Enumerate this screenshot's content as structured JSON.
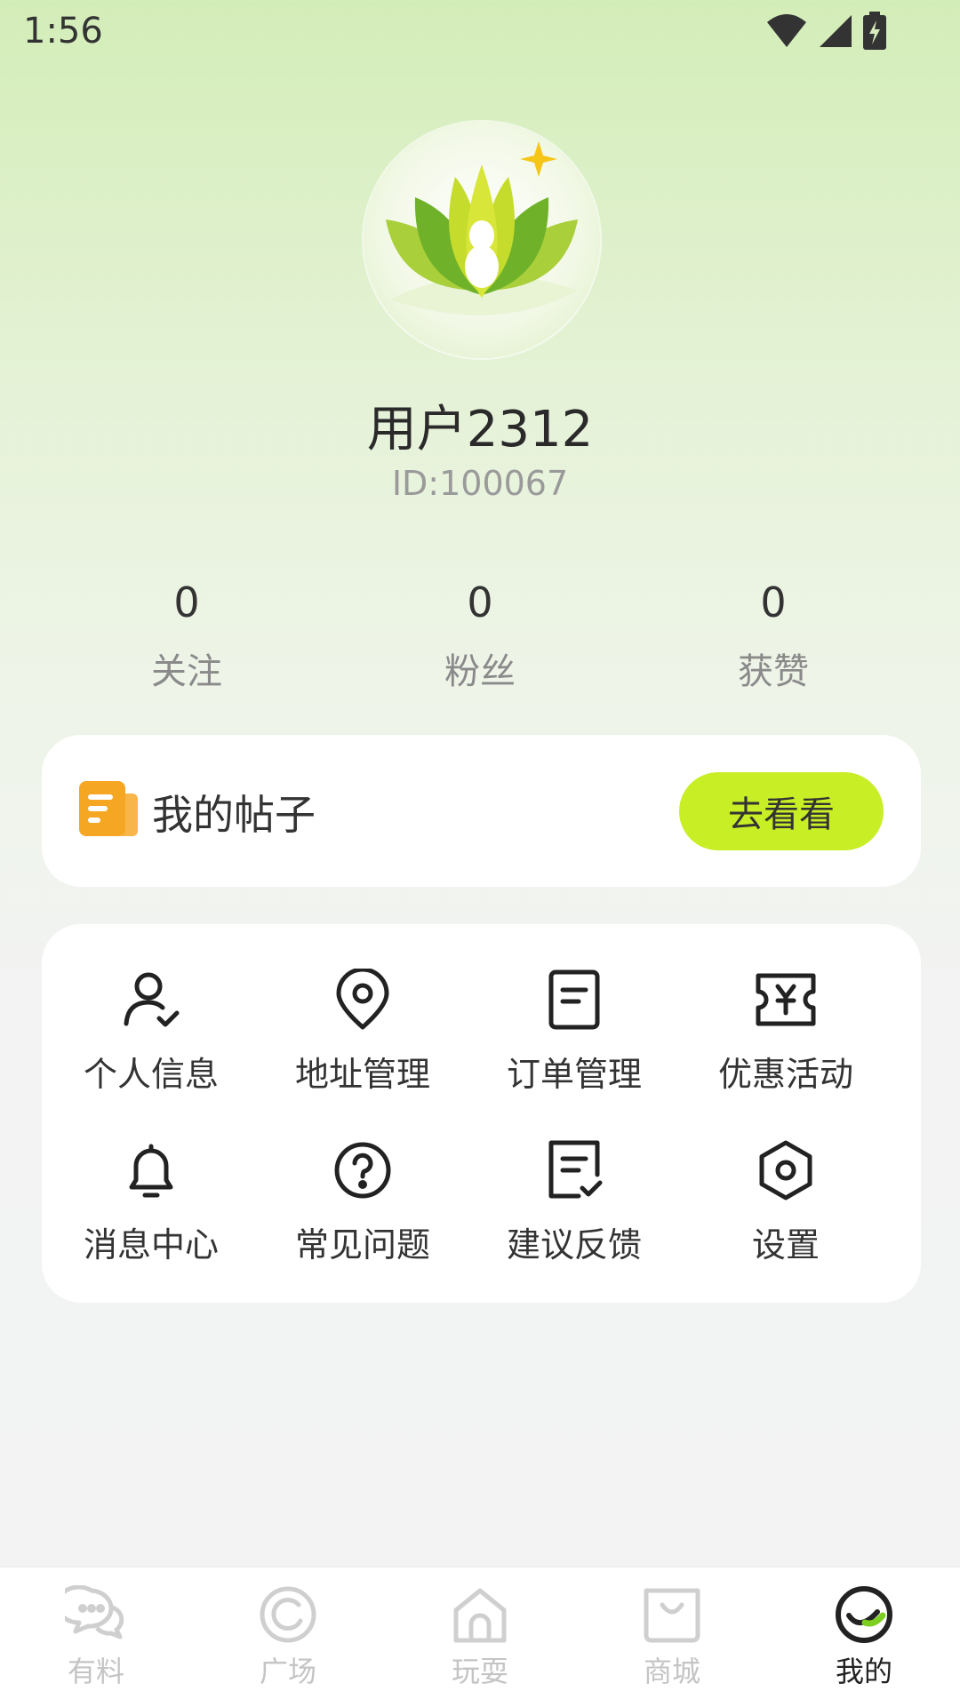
{
  "status_bar": {
    "time": "1:56",
    "icons": [
      "wifi-icon",
      "signal-icon",
      "battery-charging-icon"
    ]
  },
  "profile": {
    "avatar_icon": "lotus-logo",
    "username": "用户2312",
    "user_id": "ID:100067"
  },
  "stats": [
    {
      "value": "0",
      "label": "关注"
    },
    {
      "value": "0",
      "label": "粉丝"
    },
    {
      "value": "0",
      "label": "获赞"
    }
  ],
  "posts_card": {
    "icon": "document-icon",
    "title": "我的帖子",
    "button_label": "去看看",
    "button_color": "#c8ee26"
  },
  "menu": [
    {
      "icon": "user-check-icon",
      "label": "个人信息"
    },
    {
      "icon": "location-pin-icon",
      "label": "地址管理"
    },
    {
      "icon": "order-list-icon",
      "label": "订单管理"
    },
    {
      "icon": "coupon-yen-icon",
      "label": "优惠活动"
    },
    {
      "icon": "bell-icon",
      "label": "消息中心"
    },
    {
      "icon": "question-circle-icon",
      "label": "常见问题"
    },
    {
      "icon": "feedback-icon",
      "label": "建议反馈"
    },
    {
      "icon": "gear-hexagon-icon",
      "label": "设置"
    }
  ],
  "tabbar": {
    "active_index": 4,
    "tabs": [
      {
        "icon": "chat-bubbles-icon",
        "label": "有料"
      },
      {
        "icon": "plaza-circle-icon",
        "label": "广场"
      },
      {
        "icon": "home-icon",
        "label": "玩耍"
      },
      {
        "icon": "shopping-bag-icon",
        "label": "商城"
      },
      {
        "icon": "profile-check-icon",
        "label": "我的"
      }
    ]
  },
  "colors": {
    "accent": "#c8ee26",
    "post_icon": "#f5a623",
    "active_tab": "#222222",
    "inactive_tab": "#c4c4c4"
  }
}
